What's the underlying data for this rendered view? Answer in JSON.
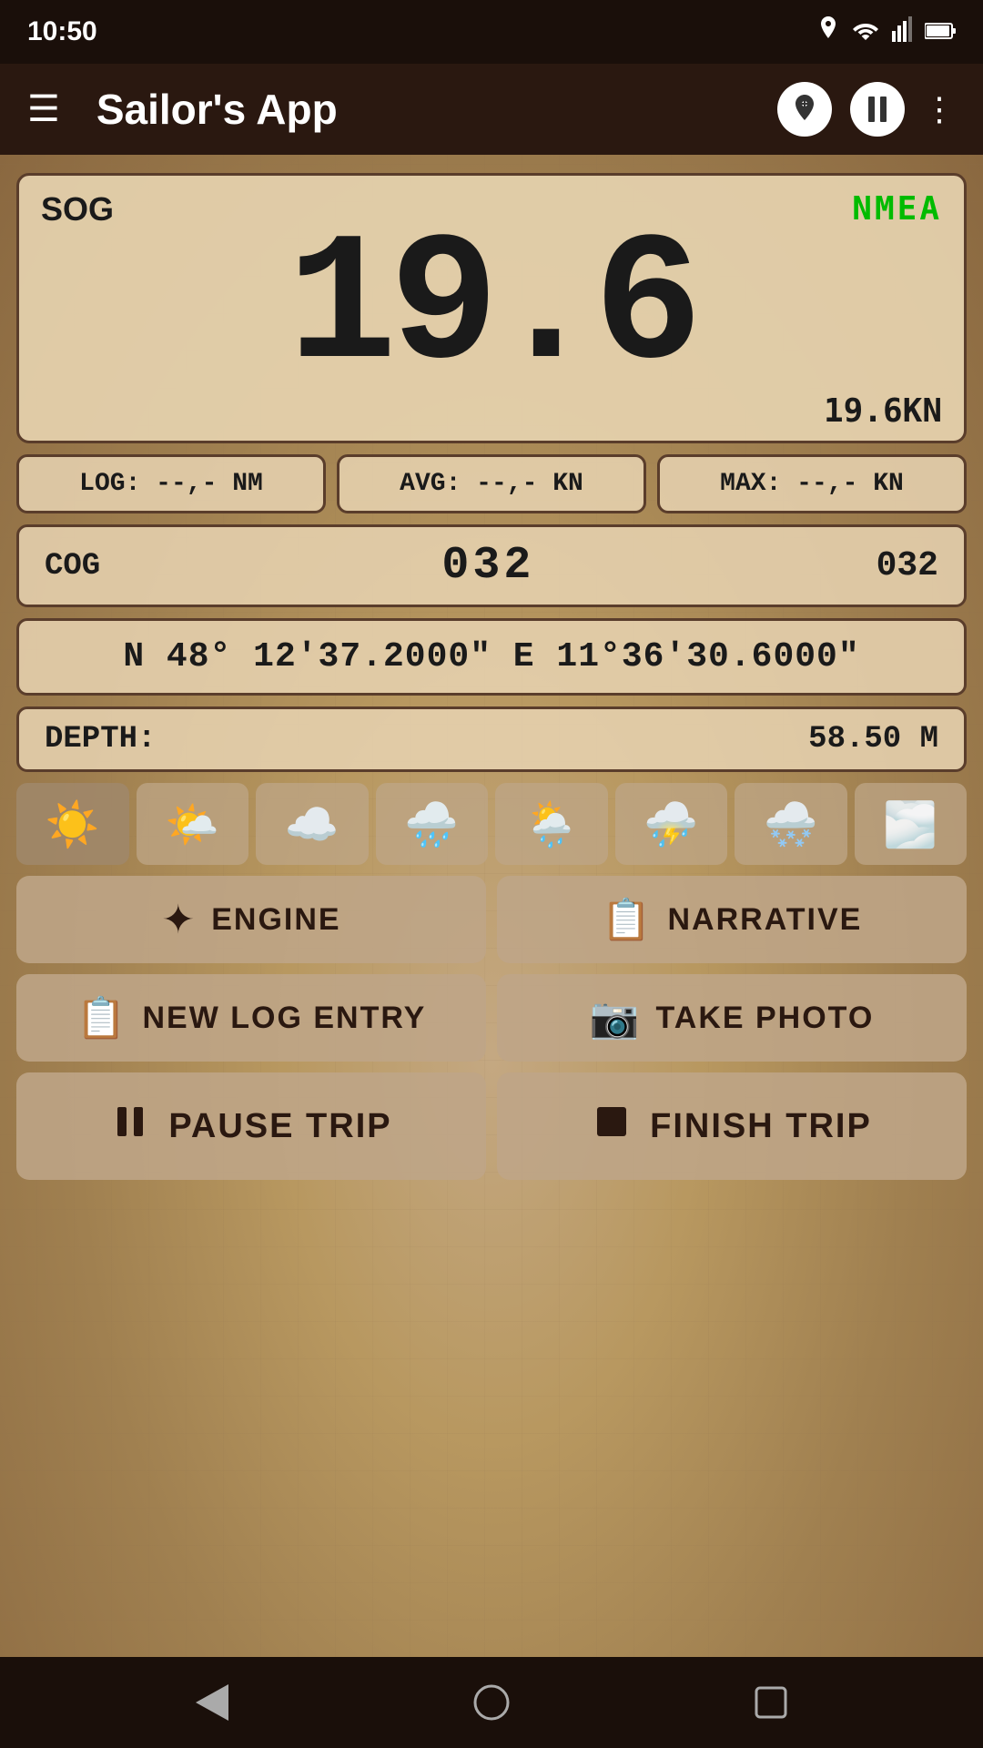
{
  "statusBar": {
    "time": "10:50"
  },
  "header": {
    "title": "Sailor's App"
  },
  "speedDisplay": {
    "sogLabel": "SOG",
    "nmeaLabel": "NMEA",
    "speedValue": "19.6",
    "speedUnit": "19.6KN"
  },
  "stats": {
    "log": "LOG:   --,- NM",
    "avg": "AVG:   --,- KN",
    "max": "MAX:   --,- KN"
  },
  "cog": {
    "label": "COG",
    "value": "032",
    "right": "032"
  },
  "coordinates": {
    "value": "N 48° 12'37.2000\"  E 11°36'30.6000\""
  },
  "depth": {
    "label": "DEPTH:",
    "value": "58.50 M"
  },
  "weather": {
    "icons": [
      "☀️",
      "🌤️",
      "☁️",
      "🌧️",
      "🌦️",
      "⛈️",
      "🌨️",
      "🌫️"
    ]
  },
  "buttons": {
    "engine": "ENGINE",
    "narrative": "NARRATIVE",
    "newLogEntry": "NEW LOG ENTRY",
    "takePhoto": "TAKE PHOTO",
    "pauseTrip": "PAUSE TRIP",
    "finishTrip": "FINISH TRIP"
  }
}
